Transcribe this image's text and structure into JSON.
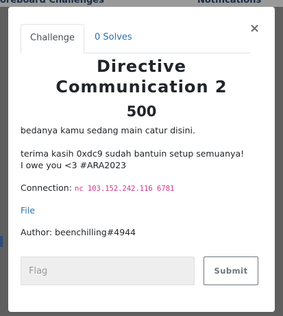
{
  "backdrop": {
    "nav_left": "oreboard  Challenges",
    "nav_right": "Notifications"
  },
  "modal": {
    "tabs": [
      {
        "label": "Challenge"
      },
      {
        "label": "0 Solves"
      }
    ],
    "close_glyph": "×",
    "title_line1": "Directive",
    "title_line2": "Communication 2",
    "value": "500",
    "description": [
      "bedanya kamu sedang main catur disini.",
      "terima kasih 0xdc9 sudah bantuin setup semuanya!",
      "I owe you <3 #ARA2023"
    ],
    "connection_label": "Connection:",
    "connection_value": "nc 103.152.242.116 6781",
    "file_link": "File",
    "author": "Author: beenchilling#4944",
    "flag_placeholder": "Flag",
    "submit_label": "Submit"
  }
}
